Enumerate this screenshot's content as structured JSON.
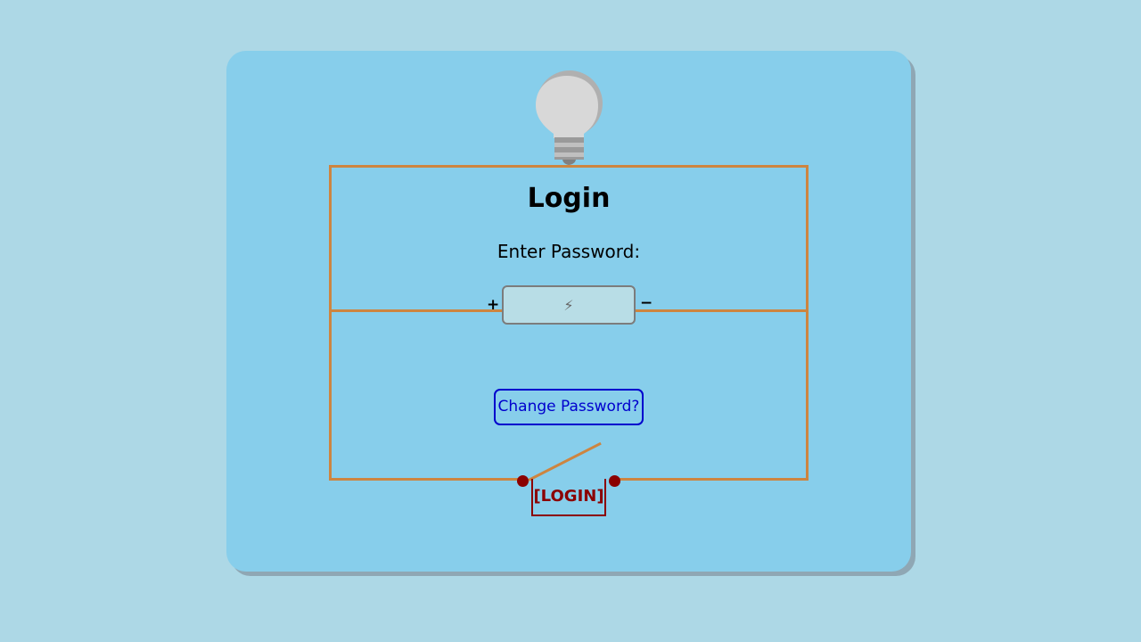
{
  "login_form": {
    "title": "Login",
    "password_label": "Enter Password:",
    "password_placeholder": "⚡",
    "password_value": "",
    "positive_terminal": "+",
    "negative_terminal": "−",
    "change_password_link": "Change Password?",
    "login_button": "[LOGIN]"
  },
  "colors": {
    "page_background": "#add8e6",
    "card_background": "#87ceeb",
    "wire": "#cd8540",
    "switch_terminal": "#8b0000",
    "login_text": "#8b0000",
    "link_text": "#0000cd"
  },
  "icons": {
    "bulb": "lightbulb-icon",
    "input_symbol": "lightning-bolt"
  }
}
